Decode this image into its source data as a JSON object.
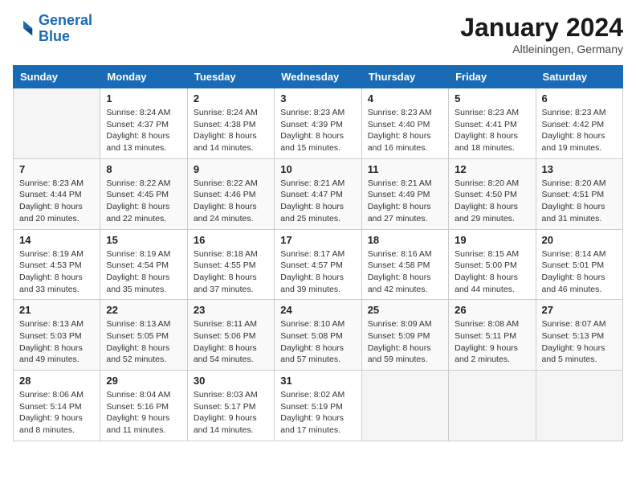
{
  "logo": {
    "line1": "General",
    "line2": "Blue"
  },
  "title": "January 2024",
  "subtitle": "Altleiningen, Germany",
  "days_of_week": [
    "Sunday",
    "Monday",
    "Tuesday",
    "Wednesday",
    "Thursday",
    "Friday",
    "Saturday"
  ],
  "weeks": [
    [
      {
        "day": "",
        "info": ""
      },
      {
        "day": "1",
        "info": "Sunrise: 8:24 AM\nSunset: 4:37 PM\nDaylight: 8 hours\nand 13 minutes."
      },
      {
        "day": "2",
        "info": "Sunrise: 8:24 AM\nSunset: 4:38 PM\nDaylight: 8 hours\nand 14 minutes."
      },
      {
        "day": "3",
        "info": "Sunrise: 8:23 AM\nSunset: 4:39 PM\nDaylight: 8 hours\nand 15 minutes."
      },
      {
        "day": "4",
        "info": "Sunrise: 8:23 AM\nSunset: 4:40 PM\nDaylight: 8 hours\nand 16 minutes."
      },
      {
        "day": "5",
        "info": "Sunrise: 8:23 AM\nSunset: 4:41 PM\nDaylight: 8 hours\nand 18 minutes."
      },
      {
        "day": "6",
        "info": "Sunrise: 8:23 AM\nSunset: 4:42 PM\nDaylight: 8 hours\nand 19 minutes."
      }
    ],
    [
      {
        "day": "7",
        "info": "Sunrise: 8:23 AM\nSunset: 4:44 PM\nDaylight: 8 hours\nand 20 minutes."
      },
      {
        "day": "8",
        "info": "Sunrise: 8:22 AM\nSunset: 4:45 PM\nDaylight: 8 hours\nand 22 minutes."
      },
      {
        "day": "9",
        "info": "Sunrise: 8:22 AM\nSunset: 4:46 PM\nDaylight: 8 hours\nand 24 minutes."
      },
      {
        "day": "10",
        "info": "Sunrise: 8:21 AM\nSunset: 4:47 PM\nDaylight: 8 hours\nand 25 minutes."
      },
      {
        "day": "11",
        "info": "Sunrise: 8:21 AM\nSunset: 4:49 PM\nDaylight: 8 hours\nand 27 minutes."
      },
      {
        "day": "12",
        "info": "Sunrise: 8:20 AM\nSunset: 4:50 PM\nDaylight: 8 hours\nand 29 minutes."
      },
      {
        "day": "13",
        "info": "Sunrise: 8:20 AM\nSunset: 4:51 PM\nDaylight: 8 hours\nand 31 minutes."
      }
    ],
    [
      {
        "day": "14",
        "info": "Sunrise: 8:19 AM\nSunset: 4:53 PM\nDaylight: 8 hours\nand 33 minutes."
      },
      {
        "day": "15",
        "info": "Sunrise: 8:19 AM\nSunset: 4:54 PM\nDaylight: 8 hours\nand 35 minutes."
      },
      {
        "day": "16",
        "info": "Sunrise: 8:18 AM\nSunset: 4:55 PM\nDaylight: 8 hours\nand 37 minutes."
      },
      {
        "day": "17",
        "info": "Sunrise: 8:17 AM\nSunset: 4:57 PM\nDaylight: 8 hours\nand 39 minutes."
      },
      {
        "day": "18",
        "info": "Sunrise: 8:16 AM\nSunset: 4:58 PM\nDaylight: 8 hours\nand 42 minutes."
      },
      {
        "day": "19",
        "info": "Sunrise: 8:15 AM\nSunset: 5:00 PM\nDaylight: 8 hours\nand 44 minutes."
      },
      {
        "day": "20",
        "info": "Sunrise: 8:14 AM\nSunset: 5:01 PM\nDaylight: 8 hours\nand 46 minutes."
      }
    ],
    [
      {
        "day": "21",
        "info": "Sunrise: 8:13 AM\nSunset: 5:03 PM\nDaylight: 8 hours\nand 49 minutes."
      },
      {
        "day": "22",
        "info": "Sunrise: 8:13 AM\nSunset: 5:05 PM\nDaylight: 8 hours\nand 52 minutes."
      },
      {
        "day": "23",
        "info": "Sunrise: 8:11 AM\nSunset: 5:06 PM\nDaylight: 8 hours\nand 54 minutes."
      },
      {
        "day": "24",
        "info": "Sunrise: 8:10 AM\nSunset: 5:08 PM\nDaylight: 8 hours\nand 57 minutes."
      },
      {
        "day": "25",
        "info": "Sunrise: 8:09 AM\nSunset: 5:09 PM\nDaylight: 8 hours\nand 59 minutes."
      },
      {
        "day": "26",
        "info": "Sunrise: 8:08 AM\nSunset: 5:11 PM\nDaylight: 9 hours\nand 2 minutes."
      },
      {
        "day": "27",
        "info": "Sunrise: 8:07 AM\nSunset: 5:13 PM\nDaylight: 9 hours\nand 5 minutes."
      }
    ],
    [
      {
        "day": "28",
        "info": "Sunrise: 8:06 AM\nSunset: 5:14 PM\nDaylight: 9 hours\nand 8 minutes."
      },
      {
        "day": "29",
        "info": "Sunrise: 8:04 AM\nSunset: 5:16 PM\nDaylight: 9 hours\nand 11 minutes."
      },
      {
        "day": "30",
        "info": "Sunrise: 8:03 AM\nSunset: 5:17 PM\nDaylight: 9 hours\nand 14 minutes."
      },
      {
        "day": "31",
        "info": "Sunrise: 8:02 AM\nSunset: 5:19 PM\nDaylight: 9 hours\nand 17 minutes."
      },
      {
        "day": "",
        "info": ""
      },
      {
        "day": "",
        "info": ""
      },
      {
        "day": "",
        "info": ""
      }
    ]
  ]
}
